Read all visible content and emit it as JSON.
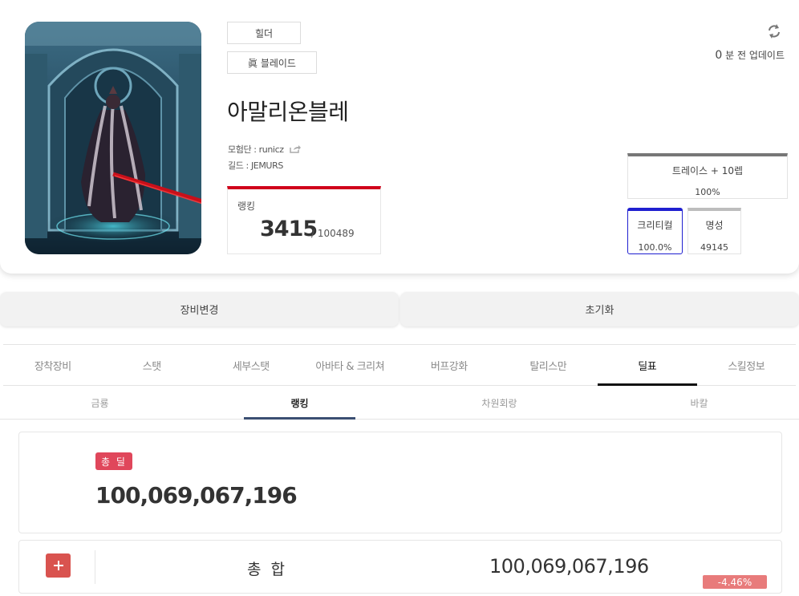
{
  "profile": {
    "job_tag": "힐더",
    "advancement_tag": "眞 블레이드",
    "character_name": "아말리온블레",
    "adventure_group": "모험단 : runicz",
    "guild": "길드 : JEMURS",
    "ranking": {
      "label": "랭킹",
      "rank": "3415",
      "total": "/ 100489"
    },
    "update": {
      "minutes": "0",
      "suffix": "분 전 업데이트"
    },
    "stats": {
      "trace": {
        "label": "트레이스 + 10렙",
        "value": "100%"
      },
      "critical": {
        "label": "크리티컬",
        "value": "100.0%"
      },
      "fame": {
        "label": "명성",
        "value": "49145"
      }
    }
  },
  "actions": {
    "equip_change": "장비변경",
    "reset": "초기화"
  },
  "main_tabs": [
    "장착장비",
    "스탯",
    "세부스탯",
    "아바타 & 크리쳐",
    "버프강화",
    "탈리스만",
    "딜표",
    "스킬정보"
  ],
  "active_main_tab": "딜표",
  "sub_tabs": [
    "금룡",
    "랭킹",
    "차원회랑",
    "바칼"
  ],
  "active_sub_tab": "랭킹",
  "damage": {
    "total_badge": "총 딜",
    "total_value": "100,069,067,196",
    "sum_label": "총 합",
    "sum_value": "100,069,067,196",
    "diff": "-4.46%"
  },
  "colors": {
    "rank_accent": "#d0021b",
    "crit_border": "#1f1fd0",
    "badge_red": "#e0475b",
    "sub_tab_active": "#3b4f72"
  }
}
